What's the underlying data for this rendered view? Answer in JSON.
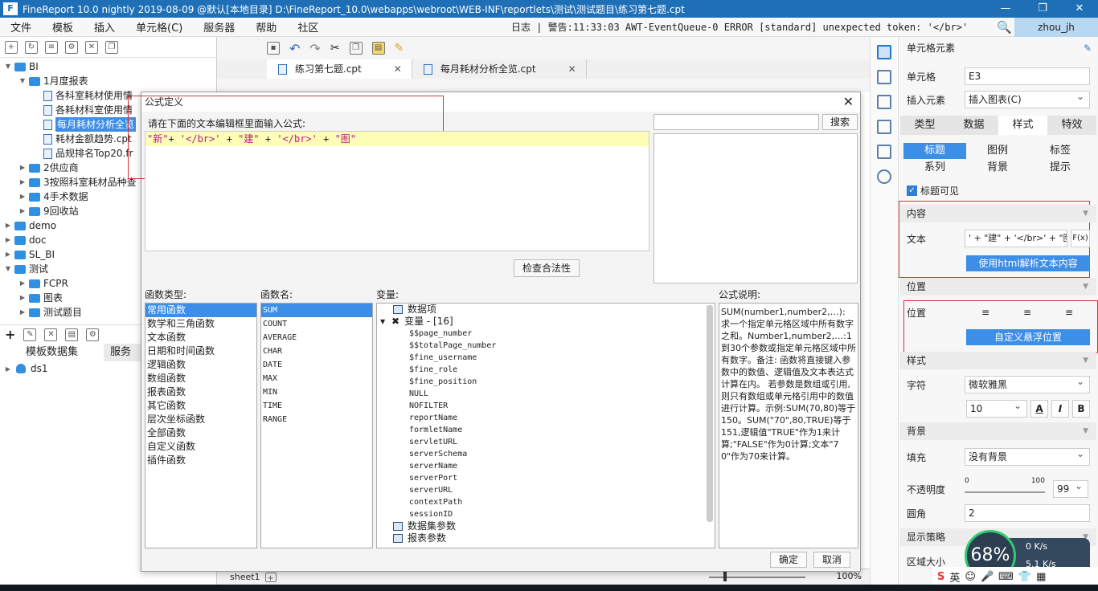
{
  "window": {
    "title": "FineReport 10.0 nightly 2019-08-09 @默认[本地目录]    D:\\FineReport_10.0\\webapps\\webroot\\WEB-INF\\reportlets\\测试\\测试题目\\练习第七题.cpt",
    "logo": "F",
    "min": "—",
    "restore": "❐",
    "close": "✕"
  },
  "menu": {
    "items": [
      "文件",
      "模板",
      "插入",
      "单元格(C)",
      "服务器",
      "帮助",
      "社区"
    ],
    "log": "日志 | 警告:11:33:03 AWT-EventQueue-0 ERROR [standard] unexpected token: '</br>'",
    "user": "zhou_jh",
    "search_icon": "🔍"
  },
  "tree": {
    "items": [
      {
        "label": "BI",
        "type": "folder",
        "depth": 0,
        "expanded": true
      },
      {
        "label": "1月度报表",
        "type": "folder",
        "depth": 1,
        "expanded": true
      },
      {
        "label": "各科室耗材使用情",
        "type": "file",
        "depth": 2
      },
      {
        "label": "各耗材科室使用情",
        "type": "file",
        "depth": 2
      },
      {
        "label": "每月耗材分析全览",
        "type": "file",
        "depth": 2,
        "selected": true
      },
      {
        "label": "耗材金额趋势.cpt",
        "type": "file",
        "depth": 2
      },
      {
        "label": "品规排名Top20.fr",
        "type": "file",
        "depth": 2
      },
      {
        "label": "2供应商",
        "type": "folder",
        "depth": 1
      },
      {
        "label": "3按照科室耗材品种查",
        "type": "folder",
        "depth": 1
      },
      {
        "label": "4手术数据",
        "type": "folder",
        "depth": 1
      },
      {
        "label": "9回收站",
        "type": "folder",
        "depth": 1
      },
      {
        "label": "demo",
        "type": "folder",
        "depth": 0
      },
      {
        "label": "doc",
        "type": "folder",
        "depth": 0
      },
      {
        "label": "SL_BI",
        "type": "folder",
        "depth": 0
      },
      {
        "label": "测试",
        "type": "folder",
        "depth": 0,
        "expanded": true
      },
      {
        "label": "FCPR",
        "type": "folder",
        "depth": 1
      },
      {
        "label": "图表",
        "type": "folder",
        "depth": 1
      },
      {
        "label": "测试题目",
        "type": "folder",
        "depth": 1
      }
    ]
  },
  "left_tabs": {
    "dataset": "模板数据集",
    "server": "服务"
  },
  "datasource": {
    "name": "ds1"
  },
  "editor_tabs": [
    {
      "label": "练习第七题.cpt",
      "active": true
    },
    {
      "label": "每月耗材分析全览.cpt",
      "active": false
    }
  ],
  "sheet": {
    "name": "sheet1",
    "zoom": "100%"
  },
  "dialog": {
    "title": "公式定义",
    "hint": "请在下面的文本编辑框里面输入公式:",
    "formula_tokens": [
      {
        "t": "\"新\"",
        "k": "q"
      },
      {
        "t": "+ ",
        "k": "p"
      },
      {
        "t": "'</br>'",
        "k": "q"
      },
      {
        "t": " + ",
        "k": "p"
      },
      {
        "t": "\"建\"",
        "k": "q"
      },
      {
        "t": " + ",
        "k": "p"
      },
      {
        "t": "'</br>'",
        "k": "q"
      },
      {
        "t": " + ",
        "k": "p"
      },
      {
        "t": "\"图\"",
        "k": "q"
      }
    ],
    "check_button": "检查合法性",
    "search_button": "搜索",
    "func_type_header": "函数类型:",
    "func_name_header": "函数名:",
    "var_header": "变量:",
    "desc_header": "公式说明:",
    "func_types": [
      "常用函数",
      "数学和三角函数",
      "文本函数",
      "日期和时间函数",
      "逻辑函数",
      "数组函数",
      "报表函数",
      "其它函数",
      "层次坐标函数",
      "全部函数",
      "自定义函数",
      "插件函数"
    ],
    "func_names": [
      "SUM",
      "COUNT",
      "AVERAGE",
      "CHAR",
      "DATE",
      "MAX",
      "MIN",
      "TIME",
      "RANGE"
    ],
    "var_data_item": "数据项",
    "var_group": "变量 - [16]",
    "variables": [
      "$$page_number",
      "$$totalPage_number",
      "$fine_username",
      "$fine_role",
      "$fine_position",
      "NULL",
      "NOFILTER",
      "reportName",
      "formletName",
      "servletURL",
      "serverSchema",
      "serverName",
      "serverPort",
      "serverURL",
      "contextPath",
      "sessionID"
    ],
    "var_dataset_params": "数据集参数",
    "var_report_params": "报表参数",
    "description": "SUM(number1,number2,…): 求一个指定单元格区域中所有数字之和。Number1,number2,…:1到30个参数或指定单元格区域中所有数字。备注:   函数将直接键入参数中的数值、逻辑值及文本表达式计算在内。   若参数是数组或引用,则只有数组或单元格引用中的数值进行计算。示例:SUM(70,80)等于150。SUM(\"70\",80,TRUE)等于151,逻辑值\"TRUE\"作为1来计算;\"FALSE\"作为0计算;文本\"70\"作为70来计算。",
    "ok": "确定",
    "cancel": "取消",
    "close": "✕"
  },
  "right_panel": {
    "header": "单元格元素",
    "cell_label": "单元格",
    "cell_value": "E3",
    "insert_label": "插入元素",
    "insert_value": "插入图表(C)",
    "main_tabs": [
      "类型",
      "数据",
      "样式",
      "特效"
    ],
    "sub_tabs": [
      "标题",
      "图例",
      "标签",
      "系列",
      "背景",
      "提示"
    ],
    "title_visible": "标题可见",
    "content_section": "内容",
    "text_label": "文本",
    "text_value": "' + \"建\" + '</br>' + \"图\"",
    "fx": "F(x)",
    "html_button": "使用html解析文本内容",
    "position_section": "位置",
    "position_label": "位置",
    "float_button": "自定义悬浮位置",
    "style_section": "样式",
    "font_label": "字符",
    "font_value": "微软雅黑",
    "font_size": "10",
    "background_section": "背景",
    "fill_label": "填充",
    "fill_value": "没有背景",
    "opacity_label": "不透明度",
    "opacity_min": "0",
    "opacity_max": "100",
    "opacity_value": "99",
    "radius_label": "圆角",
    "radius_value": "2",
    "display_section": "显示策略",
    "area_label": "区域大小",
    "bold": "A",
    "italic": "I",
    "bold2": "B"
  },
  "net_widget": {
    "percent": "68%",
    "up": "0 K/s",
    "down": "5.1 K/s"
  },
  "ime": {
    "logo": "S",
    "lang": "英"
  },
  "colors": {
    "accent": "#3d8ee6",
    "title_bar": "#1f6fb6",
    "highlight_line": "#fdfdb6",
    "string_color": "#c0168c",
    "annotation_red": "#d9303a"
  }
}
